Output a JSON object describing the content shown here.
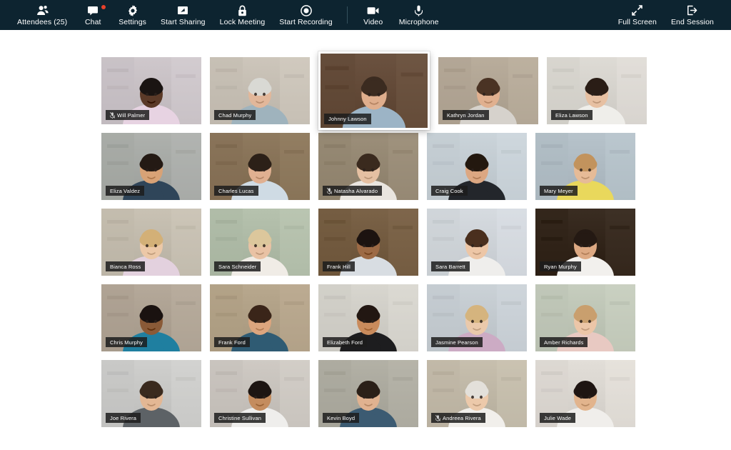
{
  "toolbar": {
    "left_items": [
      {
        "label": "Attendees (25)",
        "icon": "attendees-icon",
        "badge": false
      },
      {
        "label": "Chat",
        "icon": "chat-icon",
        "badge": true
      },
      {
        "label": "Settings",
        "icon": "gear-icon",
        "badge": false
      },
      {
        "label": "Start Sharing",
        "icon": "screen-share-icon",
        "badge": false
      },
      {
        "label": "Lock Meeting",
        "icon": "lock-icon",
        "badge": false
      },
      {
        "label": "Start Recording",
        "icon": "record-icon",
        "badge": false
      },
      {
        "label": "Video",
        "icon": "video-camera-icon",
        "badge": false
      },
      {
        "label": "Microphone",
        "icon": "microphone-icon",
        "badge": false
      }
    ],
    "right_items": [
      {
        "label": "Full Screen",
        "icon": "expand-icon"
      },
      {
        "label": "End Session",
        "icon": "exit-icon"
      }
    ],
    "background_color": "#0d2430",
    "badge_color": "#e8412a",
    "text_color": "#ffffff"
  },
  "grid": {
    "columns": 5,
    "rows": [
      [
        {
          "name": "Will Palmer",
          "muted": true,
          "active": false,
          "bg": "#cfc8cc",
          "skin": "#5b3a28",
          "shirt": "#e7d3e2",
          "hair": "#1a1412"
        },
        {
          "name": "Chad Murphy",
          "muted": false,
          "active": false,
          "bg": "#cdc6bb",
          "skin": "#e2b79a",
          "shirt": "#9fb3bd",
          "hair": "#d9d9d4"
        },
        {
          "name": "Johnny Lawson",
          "muted": false,
          "active": true,
          "bg": "#6b5240",
          "skin": "#dfae8d",
          "shirt": "#9cb4c6",
          "hair": "#3b2b20"
        },
        {
          "name": "Kathryn Jordan",
          "muted": false,
          "active": false,
          "bg": "#b9ad9c",
          "skin": "#e0b08f",
          "shirt": "#d6d2cc",
          "hair": "#4a3324"
        },
        {
          "name": "Eliza Lawson",
          "muted": false,
          "active": false,
          "bg": "#dedbd5",
          "skin": "#e7c0a2",
          "shirt": "#efeeea",
          "hair": "#2a1d16"
        }
      ],
      [
        {
          "name": "Eliza Valdez",
          "muted": false,
          "active": false,
          "bg": "#aeb1ad",
          "skin": "#d8a276",
          "shirt": "#2f4559",
          "hair": "#241a14"
        },
        {
          "name": "Charles Lucas",
          "muted": false,
          "active": false,
          "bg": "#8f7a5f",
          "skin": "#e0b091",
          "shirt": "#cfdbe4",
          "hair": "#2c2018"
        },
        {
          "name": "Natasha Alvarado",
          "muted": true,
          "active": false,
          "bg": "#9c8f7a",
          "skin": "#e5c0a2",
          "shirt": "#e9e5df",
          "hair": "#3a2a1e"
        },
        {
          "name": "Craig Cook",
          "muted": false,
          "active": false,
          "bg": "#cbd4da",
          "skin": "#dca782",
          "shirt": "#23262b",
          "hair": "#23180f"
        },
        {
          "name": "Mary Meyer",
          "muted": false,
          "active": false,
          "bg": "#b7c3cb",
          "skin": "#e6bb97",
          "shirt": "#e9d85c",
          "hair": "#c2935d"
        }
      ],
      [
        {
          "name": "Bianca Ross",
          "muted": false,
          "active": false,
          "bg": "#c9c2b4",
          "skin": "#ecc8a7",
          "shirt": "#e3d1de",
          "hair": "#d3b077"
        },
        {
          "name": "Sara Schneider",
          "muted": false,
          "active": false,
          "bg": "#b6c2ae",
          "skin": "#e9c2a4",
          "shirt": "#f0ece6",
          "hair": "#dcc79c"
        },
        {
          "name": "Frank Hill",
          "muted": false,
          "active": false,
          "bg": "#7b6348",
          "skin": "#9d6a45",
          "shirt": "#d8dde2",
          "hair": "#1c1310"
        },
        {
          "name": "Sara Barrett",
          "muted": false,
          "active": false,
          "bg": "#d6dbe0",
          "skin": "#edc6a6",
          "shirt": "#efeeec",
          "hair": "#4a2f1e"
        },
        {
          "name": "Ryan Murphy",
          "muted": false,
          "active": false,
          "bg": "#3a2d22",
          "skin": "#dda983",
          "shirt": "#f2f0ed",
          "hair": "#241913"
        }
      ],
      [
        {
          "name": "Chris Murphy",
          "muted": false,
          "active": false,
          "bg": "#b5a99a",
          "skin": "#8a5a37",
          "shirt": "#1f7fa0",
          "hair": "#1a1210"
        },
        {
          "name": "Frank Ford",
          "muted": false,
          "active": false,
          "bg": "#b8a88e",
          "skin": "#dca57e",
          "shirt": "#2f5b73",
          "hair": "#3a2519"
        },
        {
          "name": "Elizabeth Ford",
          "muted": false,
          "active": false,
          "bg": "#d8d6cf",
          "skin": "#c98b5c",
          "shirt": "#1d1d1f",
          "hair": "#221712"
        },
        {
          "name": "Jasmine Pearson",
          "muted": false,
          "active": false,
          "bg": "#cbd2d7",
          "skin": "#eac9ab",
          "shirt": "#ccabc4",
          "hair": "#d5b47e"
        },
        {
          "name": "Amber Richards",
          "muted": false,
          "active": false,
          "bg": "#c6cdbe",
          "skin": "#ecc6a8",
          "shirt": "#e8c9c2",
          "hair": "#c99f6e"
        }
      ],
      [
        {
          "name": "Joe Rivera",
          "muted": false,
          "active": false,
          "bg": "#cfcfcd",
          "skin": "#e3b794",
          "shirt": "#5d6266",
          "hair": "#3a2a1e"
        },
        {
          "name": "Christine Sullivan",
          "muted": false,
          "active": false,
          "bg": "#cfcac4",
          "skin": "#c48c5e",
          "shirt": "#efeeec",
          "hair": "#1d1512"
        },
        {
          "name": "Kevin Boyd",
          "muted": false,
          "active": false,
          "bg": "#b3b1a6",
          "skin": "#e0b290",
          "shirt": "#3c5b72",
          "hair": "#2b2018"
        },
        {
          "name": "Andreea Rivera",
          "muted": true,
          "active": false,
          "bg": "#c7bfae",
          "skin": "#ecc9aa",
          "shirt": "#f1efeb",
          "hair": "#e3e0da"
        },
        {
          "name": "Julie Wade",
          "muted": false,
          "active": false,
          "bg": "#e2ded8",
          "skin": "#e2b48d",
          "shirt": "#f0eeeb",
          "hair": "#1e1512"
        }
      ]
    ]
  }
}
